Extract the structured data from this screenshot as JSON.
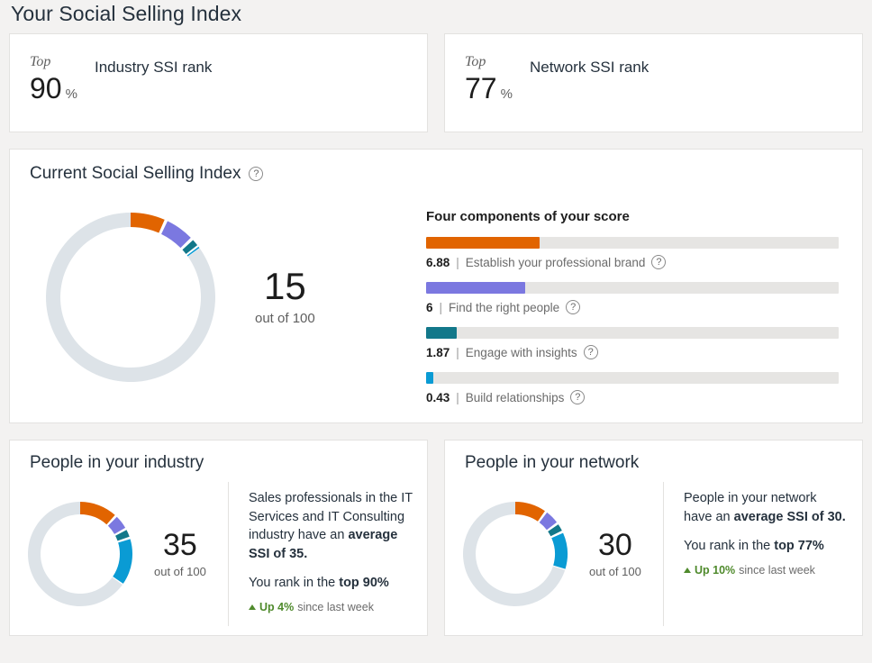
{
  "page": {
    "title": "Your Social Selling Index"
  },
  "colors": {
    "brand": "#e16400",
    "purple": "#7b78e0",
    "teal": "#12788a",
    "blue": "#0a9bd4",
    "track": "#e6e5e3",
    "ring_empty": "#dde3e8",
    "green": "#4f8a2c"
  },
  "ranks": [
    {
      "top_label": "Top",
      "value": "90",
      "percent_sign": "%",
      "title": "Industry SSI rank"
    },
    {
      "top_label": "Top",
      "value": "77",
      "percent_sign": "%",
      "title": "Network SSI rank"
    }
  ],
  "ssi": {
    "heading": "Current Social Selling Index",
    "info_icon": "question-mark-icon",
    "score": "15",
    "score_sub": "out of 100",
    "components_title": "Four components of your score",
    "components": [
      {
        "score": "6.88",
        "separator": "|",
        "label": "Establish your professional brand",
        "color": "#e16400",
        "value": 6.88,
        "max": 25
      },
      {
        "score": "6",
        "separator": "|",
        "label": "Find the right people",
        "color": "#7b78e0",
        "value": 6,
        "max": 25
      },
      {
        "score": "1.87",
        "separator": "|",
        "label": "Engage with insights",
        "color": "#12788a",
        "value": 1.87,
        "max": 25
      },
      {
        "score": "0.43",
        "separator": "|",
        "label": "Build relationships",
        "color": "#0a9bd4",
        "value": 0.43,
        "max": 25
      }
    ]
  },
  "chart_data": [
    {
      "type": "pie",
      "title": "Current Social Selling Index",
      "categories": [
        "Establish your professional brand",
        "Find the right people",
        "Engage with insights",
        "Build relationships",
        "Remaining"
      ],
      "values": [
        6.88,
        6,
        1.87,
        0.43,
        84.82
      ],
      "colors": [
        "#e16400",
        "#7b78e0",
        "#12788a",
        "#0a9bd4",
        "#dde3e8"
      ],
      "total": 100,
      "center_value": 15,
      "center_label": "out of 100"
    },
    {
      "type": "bar",
      "title": "Four components of your score",
      "categories": [
        "Establish your professional brand",
        "Find the right people",
        "Engage with insights",
        "Build relationships"
      ],
      "values": [
        6.88,
        6,
        1.87,
        0.43
      ],
      "colors": [
        "#e16400",
        "#7b78e0",
        "#12788a",
        "#0a9bd4"
      ],
      "xlim": [
        0,
        25
      ],
      "xlabel": "",
      "ylabel": "",
      "grid": false,
      "legend": "none"
    },
    {
      "type": "pie",
      "title": "People in your industry",
      "categories": [
        "Establish your professional brand",
        "Find the right people",
        "Engage with insights",
        "Build relationships",
        "Remaining"
      ],
      "values": [
        12,
        5,
        3,
        15,
        65
      ],
      "colors": [
        "#e16400",
        "#7b78e0",
        "#12788a",
        "#0a9bd4",
        "#dde3e8"
      ],
      "total": 100,
      "center_value": 35,
      "center_label": "out of 100"
    },
    {
      "type": "pie",
      "title": "People in your network",
      "categories": [
        "Establish your professional brand",
        "Find the right people",
        "Engage with insights",
        "Build relationships",
        "Remaining"
      ],
      "values": [
        10,
        5,
        3,
        12,
        70
      ],
      "colors": [
        "#e16400",
        "#7b78e0",
        "#12788a",
        "#0a9bd4",
        "#dde3e8"
      ],
      "total": 100,
      "center_value": 30,
      "center_label": "out of 100"
    }
  ],
  "people": [
    {
      "title": "People in your industry",
      "score": "35",
      "score_sub": "out of 100",
      "desc_pre": "Sales professionals in the IT Services and IT Consulting industry have an ",
      "desc_strong": "average SSI of 35.",
      "rank_pre": "You rank in the ",
      "rank_strong": "top 90%",
      "trend_strong": "Up 4%",
      "trend_rest": "since last week"
    },
    {
      "title": "People in your network",
      "score": "30",
      "score_sub": "out of 100",
      "desc_pre": "People in your network have an ",
      "desc_strong": "average SSI of 30.",
      "rank_pre": "You rank in the ",
      "rank_strong": "top 77%",
      "trend_strong": "Up 10%",
      "trend_rest": "since last week"
    }
  ]
}
